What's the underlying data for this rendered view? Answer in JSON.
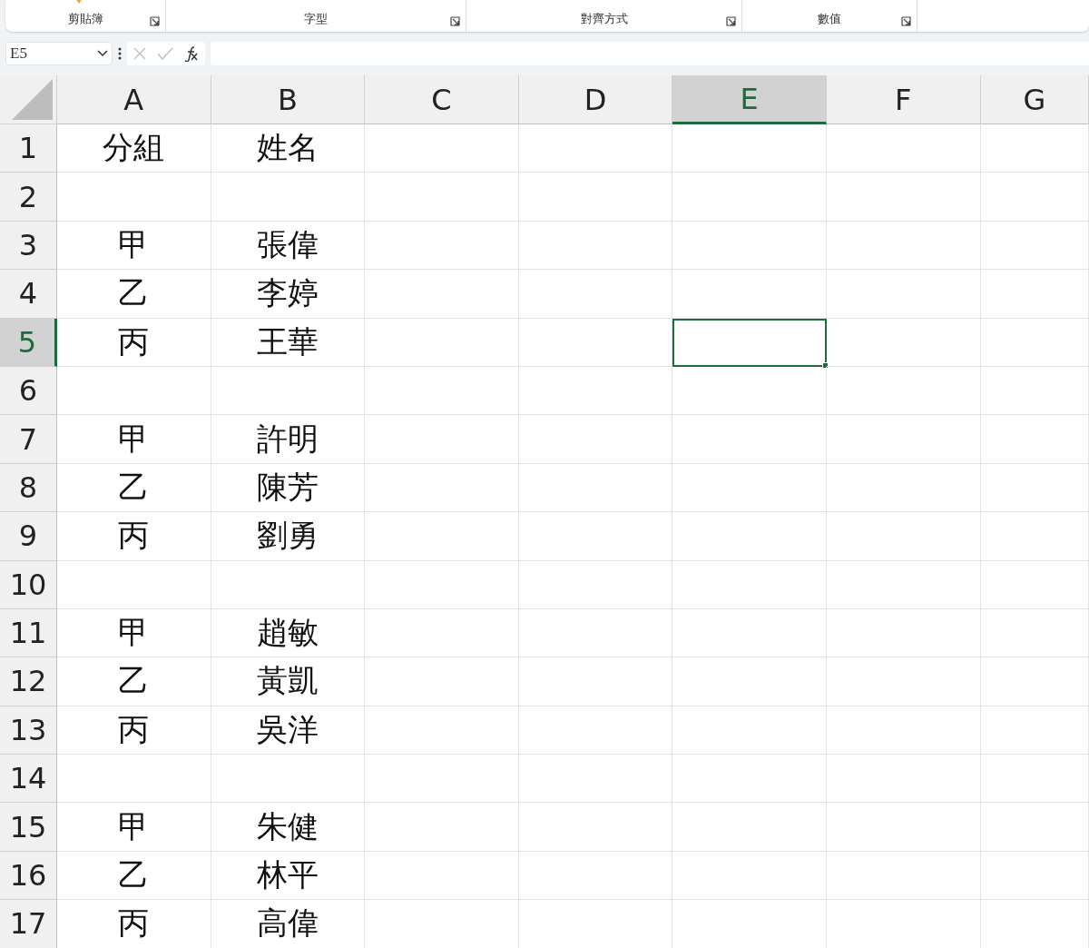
{
  "ribbon": {
    "groups": [
      {
        "label": "剪貼簿"
      },
      {
        "label": "字型"
      },
      {
        "label": "對齊方式"
      },
      {
        "label": "數值"
      }
    ]
  },
  "formula_bar": {
    "name_box": "E5"
  },
  "columns": [
    {
      "label": "A",
      "selected": false
    },
    {
      "label": "B",
      "selected": false
    },
    {
      "label": "C",
      "selected": false
    },
    {
      "label": "D",
      "selected": false
    },
    {
      "label": "E",
      "selected": true
    },
    {
      "label": "F",
      "selected": false
    },
    {
      "label": "G",
      "selected": false
    }
  ],
  "rows": [
    {
      "number": "1",
      "selected": false,
      "cells": [
        "分組",
        "姓名"
      ]
    },
    {
      "number": "2",
      "selected": false
    },
    {
      "number": "3",
      "selected": false,
      "cells": [
        "甲",
        "張偉"
      ]
    },
    {
      "number": "4",
      "selected": false,
      "cells": [
        "乙",
        "李婷"
      ]
    },
    {
      "number": "5",
      "selected": true,
      "cells": [
        "丙",
        "王華"
      ]
    },
    {
      "number": "6",
      "selected": false
    },
    {
      "number": "7",
      "selected": false,
      "cells": [
        "甲",
        "許明"
      ]
    },
    {
      "number": "8",
      "selected": false,
      "cells": [
        "乙",
        "陳芳"
      ]
    },
    {
      "number": "9",
      "selected": false,
      "cells": [
        "丙",
        "劉勇"
      ]
    },
    {
      "number": "10",
      "selected": false
    },
    {
      "number": "11",
      "selected": false,
      "cells": [
        "甲",
        "趙敏"
      ]
    },
    {
      "number": "12",
      "selected": false,
      "cells": [
        "乙",
        "黃凱"
      ]
    },
    {
      "number": "13",
      "selected": false,
      "cells": [
        "丙",
        "吳洋"
      ]
    },
    {
      "number": "14",
      "selected": false
    },
    {
      "number": "15",
      "selected": false,
      "cells": [
        "甲",
        "朱健"
      ]
    },
    {
      "number": "16",
      "selected": false,
      "cells": [
        "乙",
        "林平"
      ]
    },
    {
      "number": "17",
      "selected": false,
      "cells": [
        "丙",
        "高偉"
      ]
    }
  ]
}
